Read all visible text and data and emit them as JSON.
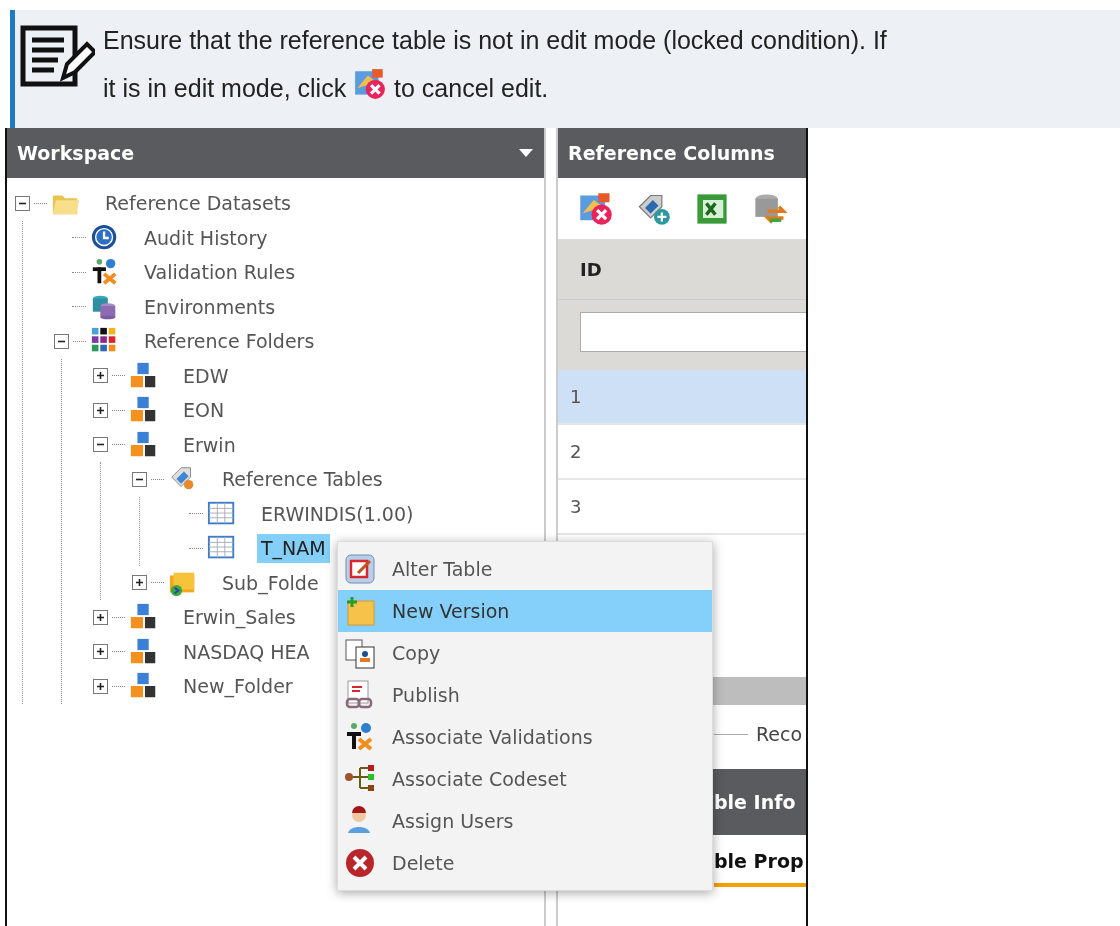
{
  "note": {
    "line_1": "Ensure that the reference table is not in edit mode (locked condition). If",
    "text_before": "it is in edit mode, click",
    "text_after": "to cancel edit."
  },
  "workspace": {
    "title": "Workspace",
    "tree": [
      {
        "label": "Reference Datasets",
        "kind": "folder",
        "expanded": true,
        "selected": false,
        "children": [
          {
            "label": "Audit History",
            "kind": "clock",
            "selected": false
          },
          {
            "label": "Validation Rules",
            "kind": "rules",
            "selected": false
          },
          {
            "label": "Environments",
            "kind": "database",
            "selected": false
          },
          {
            "label": "Reference Folders",
            "kind": "grid",
            "expanded": true,
            "selected": false,
            "children": [
              {
                "label": "EDW",
                "kind": "org",
                "expanded": false,
                "selected": false
              },
              {
                "label": "EON",
                "kind": "org",
                "expanded": false,
                "selected": false
              },
              {
                "label": "Erwin",
                "kind": "org",
                "expanded": true,
                "selected": false,
                "children": [
                  {
                    "label": "Reference Tables",
                    "kind": "tags",
                    "expanded": true,
                    "selected": false,
                    "children": [
                      {
                        "label": "ERWINDIS(1.00)",
                        "kind": "table",
                        "selected": false
                      },
                      {
                        "label": "T_NAM",
                        "kind": "table",
                        "selected": true
                      }
                    ]
                  },
                  {
                    "label": "Sub_Folde",
                    "kind": "subfolder",
                    "expanded": false,
                    "selected": false
                  }
                ]
              },
              {
                "label": "Erwin_Sales",
                "kind": "org",
                "expanded": false,
                "selected": false
              },
              {
                "label": "NASDAQ HEA",
                "kind": "org",
                "expanded": false,
                "selected": false
              },
              {
                "label": "New_Folder",
                "kind": "org",
                "expanded": false,
                "selected": false
              }
            ]
          }
        ]
      }
    ]
  },
  "reference_columns": {
    "title": "Reference Columns",
    "column": "ID",
    "rows": [
      {
        "id": "1",
        "selected": true
      },
      {
        "id": "2",
        "selected": false
      },
      {
        "id": "3",
        "selected": false
      }
    ],
    "legend": "Reco",
    "section_title": "ble Info",
    "tab": "ble Prop"
  },
  "context_menu": {
    "items": [
      {
        "label": "Alter Table",
        "kind": "alter",
        "selected": false
      },
      {
        "label": "New Version",
        "kind": "newversion",
        "selected": true
      },
      {
        "label": "Copy",
        "kind": "copy",
        "selected": false
      },
      {
        "label": "Publish",
        "kind": "publish",
        "selected": false
      },
      {
        "label": "Associate Validations",
        "kind": "rules",
        "selected": false
      },
      {
        "label": "Associate Codeset",
        "kind": "codeset",
        "selected": false
      },
      {
        "label": "Assign Users",
        "kind": "user",
        "selected": false
      },
      {
        "label": "Delete",
        "kind": "delete",
        "selected": false
      }
    ]
  }
}
